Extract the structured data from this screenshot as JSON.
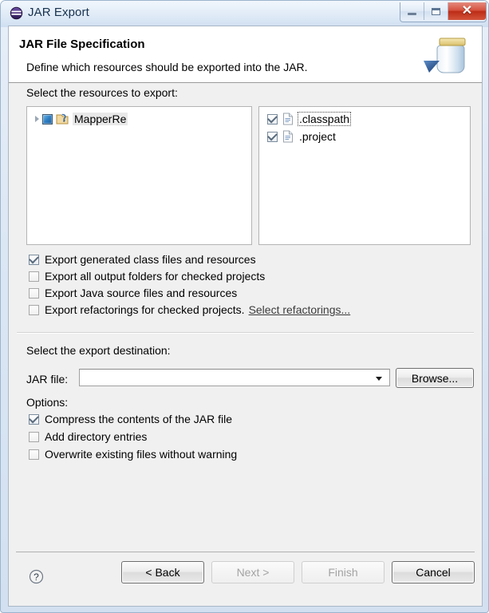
{
  "window": {
    "title": "JAR Export",
    "icon": "eclipse-icon",
    "controls": {
      "minimize": "minimize-button",
      "maximize": "maximize-button",
      "close": "close-button",
      "close_glyph": "✕"
    }
  },
  "banner": {
    "title": "JAR File Specification",
    "subtitle": "Define which resources should be exported into the JAR.",
    "icon": "jar-export-icon"
  },
  "resources": {
    "label": "Select the resources to export:",
    "tree": [
      {
        "label": "MapperRe",
        "checkbox_state": "partial",
        "expanded": false,
        "selected": true,
        "icon": "java-project-icon"
      }
    ],
    "files": [
      {
        "label": ".classpath",
        "checked": true,
        "focused": true,
        "icon": "file-icon"
      },
      {
        "label": ".project",
        "checked": true,
        "focused": false,
        "icon": "file-icon"
      }
    ]
  },
  "export_options": [
    {
      "label": "Export generated class files and resources",
      "checked": true
    },
    {
      "label": "Export all output folders for checked projects",
      "checked": false
    },
    {
      "label": "Export Java source files and resources",
      "checked": false
    },
    {
      "label": "Export refactorings for checked projects.",
      "checked": false,
      "link": "Select refactorings..."
    }
  ],
  "destination": {
    "label": "Select the export destination:",
    "jar_file_label": "JAR file:",
    "jar_file_value": "",
    "jar_file_placeholder": "",
    "browse_label": "Browse..."
  },
  "options": {
    "label": "Options:",
    "items": [
      {
        "label": "Compress the contents of the JAR file",
        "checked": true
      },
      {
        "label": "Add directory entries",
        "checked": false
      },
      {
        "label": "Overwrite existing files without warning",
        "checked": false
      }
    ]
  },
  "footer": {
    "help_icon": "help-icon",
    "buttons": [
      {
        "label": "< Back",
        "enabled": true
      },
      {
        "label": "Next >",
        "enabled": false
      },
      {
        "label": "Finish",
        "enabled": false
      },
      {
        "label": "Cancel",
        "enabled": true
      }
    ]
  },
  "colors": {
    "window_frame": "#9cb4cd",
    "client_bg": "#f0f0f0",
    "banner_bg": "#ffffff",
    "close_button": "#bd2c16",
    "checkbox_partial": "#2f7fc4",
    "title_text": "#17314e"
  }
}
